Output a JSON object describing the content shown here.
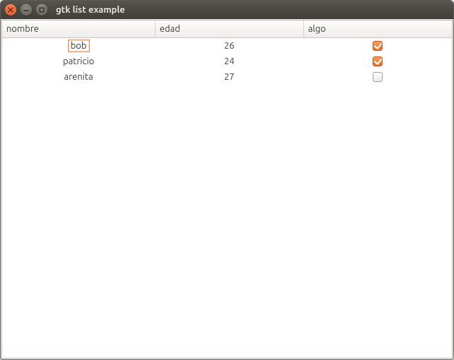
{
  "window": {
    "title": "gtk list example"
  },
  "columns": {
    "name": "nombre",
    "age": "edad",
    "something": "algo"
  },
  "rows": [
    {
      "name": "bob",
      "age": "26",
      "checked": true,
      "editing": true
    },
    {
      "name": "patricio",
      "age": "24",
      "checked": true,
      "editing": false
    },
    {
      "name": "arenita",
      "age": "27",
      "checked": false,
      "editing": false
    }
  ],
  "colors": {
    "accent": "#e5722b"
  }
}
